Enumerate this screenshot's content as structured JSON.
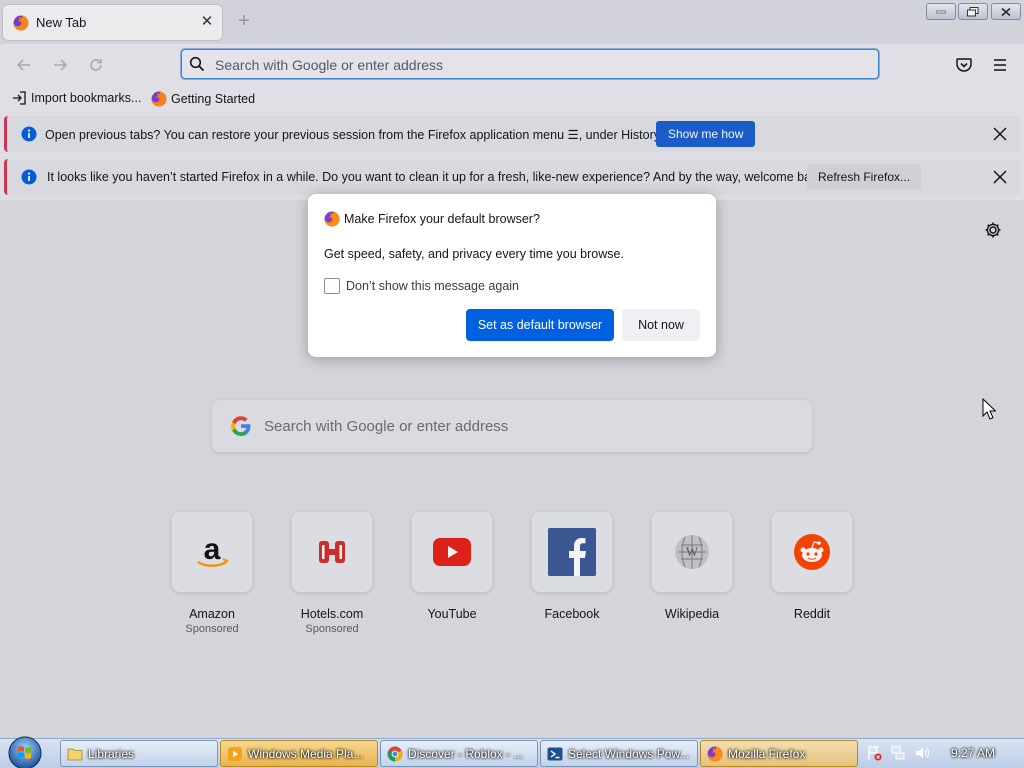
{
  "window": {
    "tab_title": "New Tab",
    "new_tab_icon": "plus-icon"
  },
  "navbar": {
    "urlbar_placeholder": "Search with Google or enter address"
  },
  "bookmarks": [
    {
      "label": "Import bookmarks...",
      "icon": "import-icon"
    },
    {
      "label": "Getting Started",
      "icon": "firefox-icon"
    }
  ],
  "notices": [
    {
      "text": "Open previous tabs? You can restore your previous session from the Firefox application menu ☰, under History.",
      "button": "Show me how"
    },
    {
      "text": "It looks like you haven’t started Firefox in a while. Do you want to clean it up for a fresh, like-new experience? And by the way, welcome back!",
      "button": "Refresh Firefox..."
    }
  ],
  "dialog": {
    "title": "Make Firefox your default browser?",
    "body": "Get speed, safety, and privacy every time you browse.",
    "checkbox_label": "Don’t show this message again",
    "checkbox_checked": false,
    "primary_button": "Set as default browser",
    "secondary_button": "Not now"
  },
  "newtab": {
    "search_placeholder": "Search with Google or enter address",
    "top_sites": [
      {
        "name": "Amazon",
        "sub": "Sponsored",
        "icon": "amazon-icon"
      },
      {
        "name": "Hotels.com",
        "sub": "Sponsored",
        "icon": "hotels-icon"
      },
      {
        "name": "YouTube",
        "sub": "",
        "icon": "youtube-icon"
      },
      {
        "name": "Facebook",
        "sub": "",
        "icon": "facebook-icon"
      },
      {
        "name": "Wikipedia",
        "sub": "",
        "icon": "wikipedia-icon"
      },
      {
        "name": "Reddit",
        "sub": "",
        "icon": "reddit-icon"
      }
    ]
  },
  "taskbar": {
    "items": [
      {
        "label": "Libraries",
        "icon": "folder-icon"
      },
      {
        "label": "Windows Media Pla...",
        "icon": "media-player-icon"
      },
      {
        "label": "Discover - Roblox - ...",
        "icon": "chrome-icon"
      },
      {
        "label": "Select Windows Pow...",
        "icon": "powershell-icon"
      },
      {
        "label": "Mozilla Firefox",
        "icon": "firefox-icon"
      }
    ],
    "clock": "9:27 AM"
  },
  "colors": {
    "primary_blue": "#0061e0",
    "notice_button_blue": "#1c5fd0",
    "notice_accent": "#d3365a"
  }
}
